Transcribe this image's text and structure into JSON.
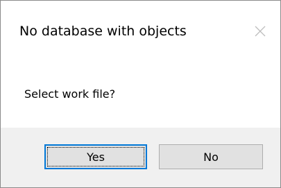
{
  "dialog": {
    "title": "No database with objects",
    "close_icon": "close-icon",
    "message": "Select work file?",
    "buttons": {
      "yes_label": "Yes",
      "no_label": "No"
    }
  },
  "colors": {
    "accent": "#0078d7",
    "footer_bg": "#f0f0f0",
    "button_bg": "#e1e1e1"
  }
}
